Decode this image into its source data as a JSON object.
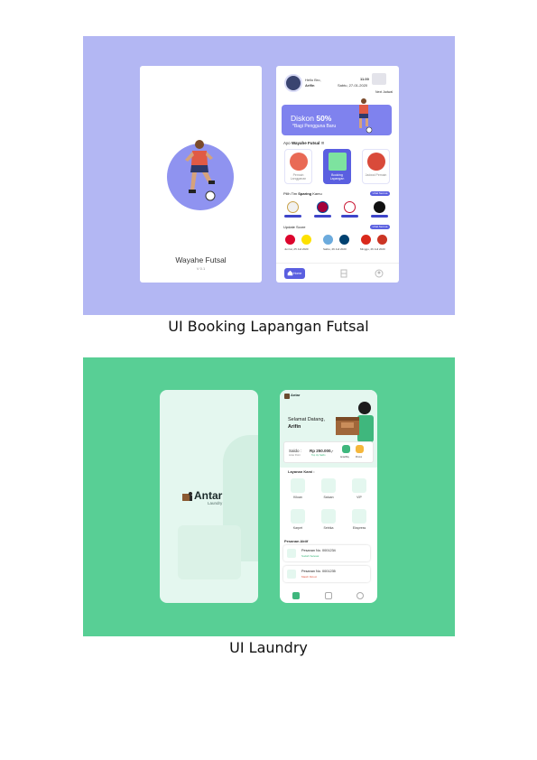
{
  "futsal": {
    "caption": "UI Booking Lapangan Futsal",
    "splash": {
      "app_name": "Wayahe Futsal",
      "version": "V 0.1"
    },
    "home": {
      "greeting": "Hello Bro,",
      "user_name": "Arifin",
      "date": "Sabtu, 27-01-2020",
      "time": "11.00",
      "next_label": "Next Jadwal",
      "banner_title_plain": "Diskon ",
      "banner_title_bold": "50%",
      "banner_subtitle": "*Bagi Pengguna Baru",
      "section_play_plain": "Ayo ",
      "section_play_bold": "Wayahe Futsal",
      "section_play_suffix": " !!!",
      "menu": [
        {
          "label": "Pemain Langganan",
          "active": false
        },
        {
          "label": "Booking Lapangan",
          "active": true
        },
        {
          "label": "Jadwal Pemain",
          "active": false
        }
      ],
      "sparing_plain": "Pilih Tim ",
      "sparing_bold": "Sparing",
      "sparing_suffix": " Kamu",
      "sparing_all": "Lihat Semua",
      "update_score": "Update Score",
      "score_all": "Lihat Semua",
      "matches": [
        {
          "date": "Jum'at, 25 Juli 2020"
        },
        {
          "date": "Sabtu, 26 Juli 2020"
        },
        {
          "date": "Minggu, 26 Juli 2020"
        }
      ],
      "nav_home": "Home"
    },
    "colors": {
      "panel": "#b3b7f3",
      "accent": "#5a5fe0"
    }
  },
  "laundry": {
    "caption": "UI Laundry",
    "splash": {
      "brand": "Antar",
      "brand_sub": "Laundry"
    },
    "home": {
      "brand": "Antar",
      "welcome": "Selamat Datang,",
      "user_name": "Arifin",
      "saldo_label": "Saldo :",
      "saldo_value": "Rp 250.000,-",
      "points": "Antar Point",
      "top_up": "Top Up Saldo",
      "pay_a": "AntarPay",
      "pay_b": "Promo",
      "services_title": "Layanan Kami :",
      "services": [
        "Kiloan",
        "Satuan",
        "VIP",
        "Karpet",
        "Setrika",
        "Ekspress"
      ],
      "orders_title": "Pesanan Aktif",
      "orders": [
        {
          "title": "Pesanan No. 0001234",
          "status": "Sudah Selesai"
        },
        {
          "title": "Pesanan No. 0001235",
          "status": "Masih Dicuci"
        }
      ]
    },
    "colors": {
      "panel": "#58cf95",
      "accent": "#3fb77d"
    }
  }
}
